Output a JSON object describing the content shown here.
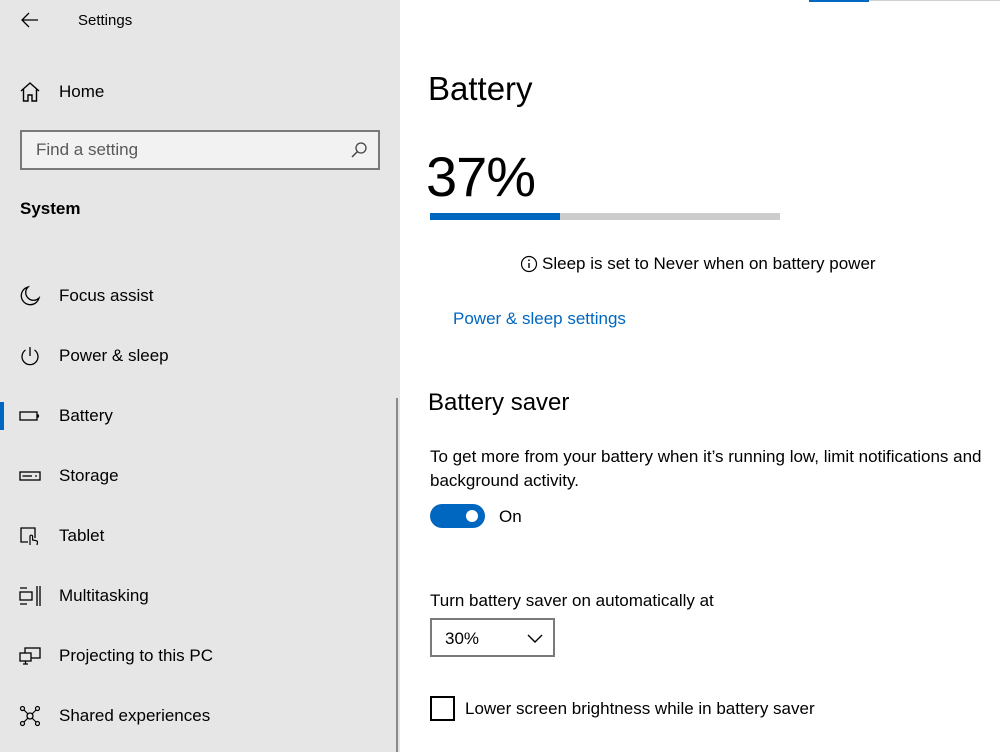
{
  "app": {
    "title": "Settings"
  },
  "sidebar": {
    "home_label": "Home",
    "search_placeholder": "Find a setting",
    "section_title": "System",
    "items": [
      {
        "label": "Focus assist",
        "icon": "moon-icon"
      },
      {
        "label": "Power & sleep",
        "icon": "power-icon"
      },
      {
        "label": "Battery",
        "icon": "battery-icon",
        "selected": true
      },
      {
        "label": "Storage",
        "icon": "storage-icon"
      },
      {
        "label": "Tablet",
        "icon": "tablet-icon"
      },
      {
        "label": "Multitasking",
        "icon": "multitasking-icon"
      },
      {
        "label": "Projecting to this PC",
        "icon": "projecting-icon"
      },
      {
        "label": "Shared experiences",
        "icon": "shared-experiences-icon"
      }
    ]
  },
  "main": {
    "title": "Battery",
    "percent_text": "37%",
    "percent_value": 0.37,
    "info_text": "Sleep is set to Never when on battery power",
    "power_link": "Power & sleep settings",
    "saver": {
      "heading": "Battery saver",
      "description": "To get more from your battery when it’s running low, limit notifications and background activity.",
      "toggle_state": "On",
      "auto_label": "Turn battery saver on automatically at",
      "auto_value": "30%",
      "brightness_label": "Lower screen brightness while in battery saver"
    }
  },
  "colors": {
    "accent": "#0067c0",
    "sidebar_bg": "#e6e6e6"
  }
}
